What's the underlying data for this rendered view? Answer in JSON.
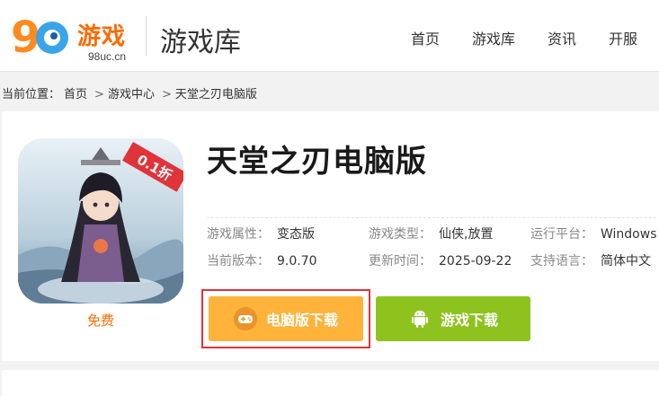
{
  "logo": {
    "brand": "游戏",
    "domain": "98uc.cn",
    "number": "98"
  },
  "header": {
    "section_title": "游戏库"
  },
  "nav": [
    {
      "label": "首页"
    },
    {
      "label": "游戏库"
    },
    {
      "label": "资讯"
    },
    {
      "label": "开服"
    }
  ],
  "breadcrumb": {
    "prefix": "当前位置：",
    "items": [
      "首页",
      "游戏中心",
      "天堂之刃电脑版"
    ],
    "separator": ">"
  },
  "game": {
    "title": "天堂之刃电脑版",
    "price": "免费",
    "badge": "0.1折",
    "info": [
      {
        "label": "游戏属性：",
        "value": "变态版"
      },
      {
        "label": "游戏类型：",
        "value": "仙侠,放置"
      },
      {
        "label": "运行平台：",
        "value": "Windows"
      },
      {
        "label": "当前版本：",
        "value": "9.0.70"
      },
      {
        "label": "更新时间：",
        "value": "2025-09-22"
      },
      {
        "label": "支持语言：",
        "value": "简体中文"
      }
    ]
  },
  "buttons": {
    "pc_download": "电脑版下载",
    "game_download": "游戏下载"
  },
  "colors": {
    "accent_orange": "#ff6a00",
    "pc_button": "#ffb33a",
    "game_button": "#8ec31f",
    "highlight_frame": "#e0333a"
  }
}
